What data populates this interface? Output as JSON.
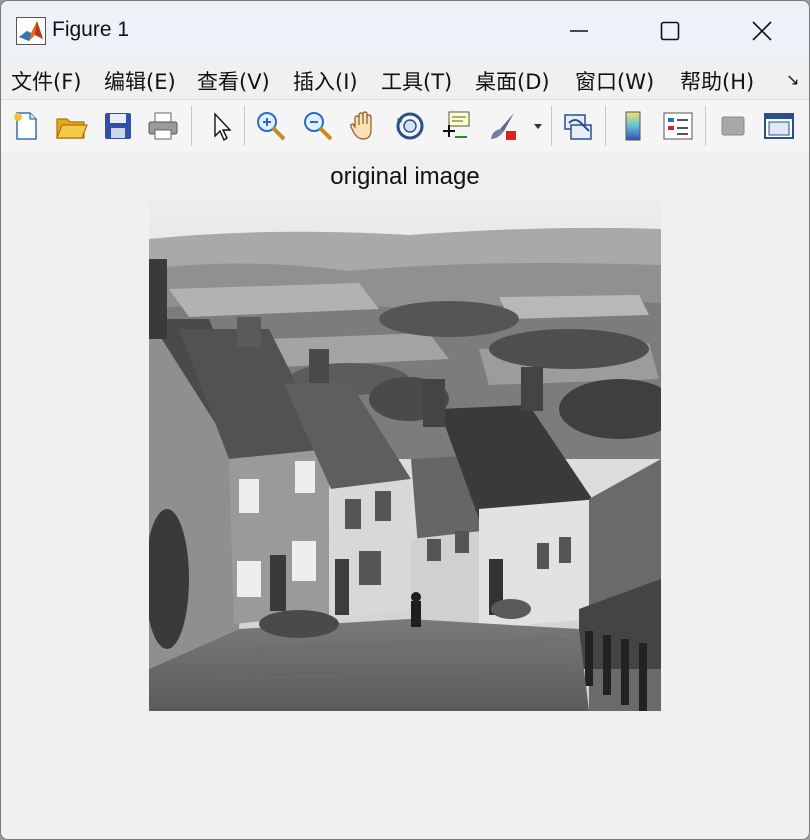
{
  "window": {
    "title": "Figure 1",
    "controls": {
      "minimize": "minimize-icon",
      "maximize": "maximize-icon",
      "close": "close-icon"
    }
  },
  "menubar": {
    "items": [
      {
        "label": "文件(F)"
      },
      {
        "label": "编辑(E)"
      },
      {
        "label": "查看(V)"
      },
      {
        "label": "插入(I)"
      },
      {
        "label": "工具(T)"
      },
      {
        "label": "桌面(D)"
      },
      {
        "label": "窗口(W)"
      },
      {
        "label": "帮助(H)"
      }
    ],
    "overflow_icon": "overflow-arrow-icon"
  },
  "toolbar": {
    "buttons": [
      "new-figure-icon",
      "open-file-icon",
      "save-icon",
      "print-icon",
      "select-pointer-icon",
      "zoom-in-icon",
      "zoom-out-icon",
      "pan-hand-icon",
      "rotate-3d-icon",
      "data-cursor-icon",
      "brush-icon",
      "brush-dropdown-icon",
      "link-plot-icon",
      "colorbar-icon",
      "legend-icon",
      "hide-plot-tools-icon",
      "show-plot-tools-icon"
    ]
  },
  "axes": {
    "title": "original image",
    "image": {
      "type": "grayscale photograph",
      "subject": "village-street-icon"
    }
  },
  "colors": {
    "titlebar": "#eef2f8",
    "background": "#f0f0f0",
    "toolbar": "#f5f5f5"
  }
}
